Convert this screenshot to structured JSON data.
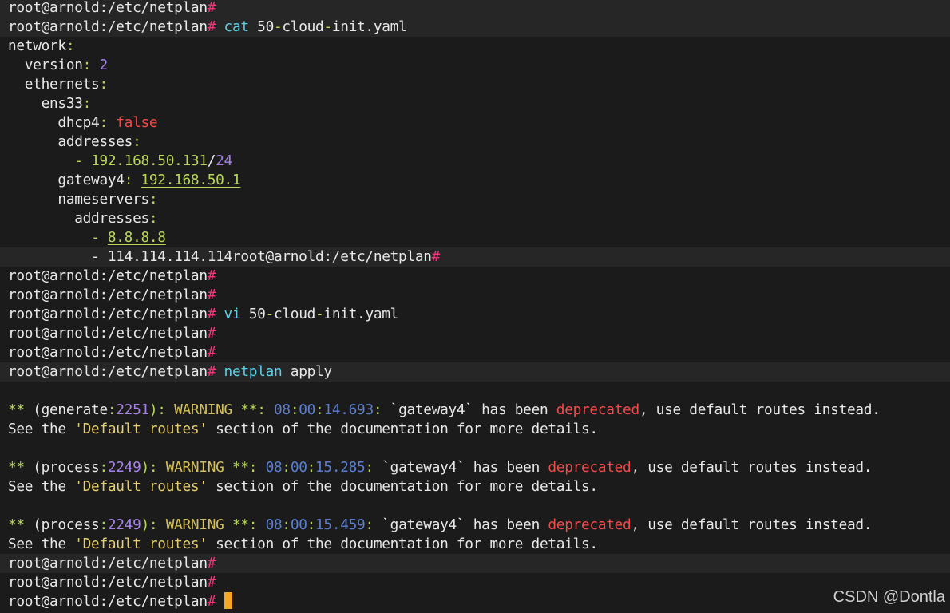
{
  "colors": {
    "default": "#e8e8e8",
    "prompt_hash": "#f0357a",
    "command": "#5ad0e6",
    "yaml_punct": "#b9d75a",
    "number": "#a682e6",
    "bool_false": "#f24a4a",
    "ip": "#b9d75a",
    "warning": "#d4c05a",
    "timestamp": "#5a7fd0",
    "deprecated": "#f24a4a",
    "quoted": "#e6cf6e",
    "cursor": "#f5a623",
    "highlight_bg": "#262626"
  },
  "cursor_line": 31,
  "lines": [
    {
      "hl": true,
      "segments": [
        {
          "text": "root@arnold:/etc/netplan",
          "c": "default"
        },
        {
          "text": "#",
          "c": "prompt_hash"
        }
      ]
    },
    {
      "hl": true,
      "segments": [
        {
          "text": "root@arnold:/etc/netplan",
          "c": "default"
        },
        {
          "text": "# ",
          "c": "prompt_hash"
        },
        {
          "text": "cat",
          "c": "command"
        },
        {
          "text": " 50",
          "c": "default"
        },
        {
          "text": "-",
          "c": "yaml_punct"
        },
        {
          "text": "cloud",
          "c": "default"
        },
        {
          "text": "-",
          "c": "yaml_punct"
        },
        {
          "text": "init.yaml",
          "c": "default"
        }
      ]
    },
    {
      "hl": false,
      "segments": [
        {
          "text": "network",
          "c": "default"
        },
        {
          "text": ":",
          "c": "yaml_punct"
        }
      ]
    },
    {
      "hl": false,
      "segments": [
        {
          "text": "  version",
          "c": "default"
        },
        {
          "text": ": ",
          "c": "yaml_punct"
        },
        {
          "text": "2",
          "c": "number"
        }
      ]
    },
    {
      "hl": false,
      "segments": [
        {
          "text": "  ethernets",
          "c": "default"
        },
        {
          "text": ":",
          "c": "yaml_punct"
        }
      ]
    },
    {
      "hl": false,
      "segments": [
        {
          "text": "    ens33",
          "c": "default"
        },
        {
          "text": ":",
          "c": "yaml_punct"
        }
      ]
    },
    {
      "hl": false,
      "segments": [
        {
          "text": "      dhcp4",
          "c": "default"
        },
        {
          "text": ": ",
          "c": "yaml_punct"
        },
        {
          "text": "false",
          "c": "bool_false"
        }
      ]
    },
    {
      "hl": false,
      "segments": [
        {
          "text": "      addresses",
          "c": "default"
        },
        {
          "text": ":",
          "c": "yaml_punct"
        }
      ]
    },
    {
      "hl": false,
      "segments": [
        {
          "text": "        ",
          "c": "default"
        },
        {
          "text": "- ",
          "c": "yaml_punct"
        },
        {
          "text": "192.168.50.131",
          "c": "ip",
          "u": true
        },
        {
          "text": "/",
          "c": "default"
        },
        {
          "text": "24",
          "c": "number"
        }
      ]
    },
    {
      "hl": false,
      "segments": [
        {
          "text": "      gateway4",
          "c": "default"
        },
        {
          "text": ": ",
          "c": "yaml_punct"
        },
        {
          "text": "192.168.50.1",
          "c": "ip",
          "u": true
        }
      ]
    },
    {
      "hl": false,
      "segments": [
        {
          "text": "      nameservers",
          "c": "default"
        },
        {
          "text": ":",
          "c": "yaml_punct"
        }
      ]
    },
    {
      "hl": false,
      "segments": [
        {
          "text": "        addresses",
          "c": "default"
        },
        {
          "text": ":",
          "c": "yaml_punct"
        }
      ]
    },
    {
      "hl": false,
      "segments": [
        {
          "text": "          ",
          "c": "default"
        },
        {
          "text": "- ",
          "c": "yaml_punct"
        },
        {
          "text": "8.8.8.8",
          "c": "ip",
          "u": true
        }
      ]
    },
    {
      "hl": true,
      "segments": [
        {
          "text": "          - 114.114.114.114root@arnold:/etc/netplan",
          "c": "default"
        },
        {
          "text": "#",
          "c": "prompt_hash"
        }
      ]
    },
    {
      "hl": false,
      "segments": [
        {
          "text": "root@arnold:/etc/netplan",
          "c": "default"
        },
        {
          "text": "#",
          "c": "prompt_hash"
        }
      ]
    },
    {
      "hl": false,
      "segments": [
        {
          "text": "root@arnold:/etc/netplan",
          "c": "default"
        },
        {
          "text": "#",
          "c": "prompt_hash"
        }
      ]
    },
    {
      "hl": false,
      "segments": [
        {
          "text": "root@arnold:/etc/netplan",
          "c": "default"
        },
        {
          "text": "# ",
          "c": "prompt_hash"
        },
        {
          "text": "vi",
          "c": "command"
        },
        {
          "text": " 50",
          "c": "default"
        },
        {
          "text": "-",
          "c": "yaml_punct"
        },
        {
          "text": "cloud",
          "c": "default"
        },
        {
          "text": "-",
          "c": "yaml_punct"
        },
        {
          "text": "init.yaml",
          "c": "default"
        }
      ]
    },
    {
      "hl": false,
      "segments": [
        {
          "text": "root@arnold:/etc/netplan",
          "c": "default"
        },
        {
          "text": "#",
          "c": "prompt_hash"
        }
      ]
    },
    {
      "hl": false,
      "segments": [
        {
          "text": "root@arnold:/etc/netplan",
          "c": "default"
        },
        {
          "text": "#",
          "c": "prompt_hash"
        }
      ]
    },
    {
      "hl": true,
      "segments": [
        {
          "text": "root@arnold:/etc/netplan",
          "c": "default"
        },
        {
          "text": "# ",
          "c": "prompt_hash"
        },
        {
          "text": "netplan",
          "c": "command"
        },
        {
          "text": " apply",
          "c": "default"
        }
      ]
    },
    {
      "hl": false,
      "segments": []
    },
    {
      "hl": false,
      "segments": [
        {
          "text": "** ",
          "c": "yaml_punct"
        },
        {
          "text": "(generate",
          "c": "default"
        },
        {
          "text": ":",
          "c": "yaml_punct"
        },
        {
          "text": "2251",
          "c": "number"
        },
        {
          "text": "): ",
          "c": "yaml_punct"
        },
        {
          "text": "WARNING ",
          "c": "warning"
        },
        {
          "text": "**",
          "c": "yaml_punct"
        },
        {
          "text": ": ",
          "c": "yaml_punct"
        },
        {
          "text": "08",
          "c": "timestamp"
        },
        {
          "text": ":",
          "c": "yaml_punct"
        },
        {
          "text": "00",
          "c": "timestamp"
        },
        {
          "text": ":",
          "c": "yaml_punct"
        },
        {
          "text": "14.693",
          "c": "timestamp"
        },
        {
          "text": ": ",
          "c": "yaml_punct"
        },
        {
          "text": "`gateway4` has been ",
          "c": "default"
        },
        {
          "text": "deprecated",
          "c": "deprecated"
        },
        {
          "text": ", use default routes instead.",
          "c": "default"
        }
      ]
    },
    {
      "hl": false,
      "segments": [
        {
          "text": "See the ",
          "c": "default"
        },
        {
          "text": "'Default routes'",
          "c": "quoted"
        },
        {
          "text": " section of the documentation for more details.",
          "c": "default"
        }
      ]
    },
    {
      "hl": false,
      "segments": []
    },
    {
      "hl": false,
      "segments": [
        {
          "text": "** ",
          "c": "yaml_punct"
        },
        {
          "text": "(process",
          "c": "default"
        },
        {
          "text": ":",
          "c": "yaml_punct"
        },
        {
          "text": "2249",
          "c": "number"
        },
        {
          "text": "): ",
          "c": "yaml_punct"
        },
        {
          "text": "WARNING ",
          "c": "warning"
        },
        {
          "text": "**",
          "c": "yaml_punct"
        },
        {
          "text": ": ",
          "c": "yaml_punct"
        },
        {
          "text": "08",
          "c": "timestamp"
        },
        {
          "text": ":",
          "c": "yaml_punct"
        },
        {
          "text": "00",
          "c": "timestamp"
        },
        {
          "text": ":",
          "c": "yaml_punct"
        },
        {
          "text": "15.285",
          "c": "timestamp"
        },
        {
          "text": ": ",
          "c": "yaml_punct"
        },
        {
          "text": "`gateway4` has been ",
          "c": "default"
        },
        {
          "text": "deprecated",
          "c": "deprecated"
        },
        {
          "text": ", use default routes instead.",
          "c": "default"
        }
      ]
    },
    {
      "hl": false,
      "segments": [
        {
          "text": "See the ",
          "c": "default"
        },
        {
          "text": "'Default routes'",
          "c": "quoted"
        },
        {
          "text": " section of the documentation for more details.",
          "c": "default"
        }
      ]
    },
    {
      "hl": false,
      "segments": []
    },
    {
      "hl": false,
      "segments": [
        {
          "text": "** ",
          "c": "yaml_punct"
        },
        {
          "text": "(process",
          "c": "default"
        },
        {
          "text": ":",
          "c": "yaml_punct"
        },
        {
          "text": "2249",
          "c": "number"
        },
        {
          "text": "): ",
          "c": "yaml_punct"
        },
        {
          "text": "WARNING ",
          "c": "warning"
        },
        {
          "text": "**",
          "c": "yaml_punct"
        },
        {
          "text": ": ",
          "c": "yaml_punct"
        },
        {
          "text": "08",
          "c": "timestamp"
        },
        {
          "text": ":",
          "c": "yaml_punct"
        },
        {
          "text": "00",
          "c": "timestamp"
        },
        {
          "text": ":",
          "c": "yaml_punct"
        },
        {
          "text": "15.459",
          "c": "timestamp"
        },
        {
          "text": ": ",
          "c": "yaml_punct"
        },
        {
          "text": "`gateway4` has been ",
          "c": "default"
        },
        {
          "text": "deprecated",
          "c": "deprecated"
        },
        {
          "text": ", use default routes instead.",
          "c": "default"
        }
      ]
    },
    {
      "hl": false,
      "segments": [
        {
          "text": "See the ",
          "c": "default"
        },
        {
          "text": "'Default routes'",
          "c": "quoted"
        },
        {
          "text": " section of the documentation for more details.",
          "c": "default"
        }
      ]
    },
    {
      "hl": true,
      "segments": [
        {
          "text": "root@arnold:/etc/netplan",
          "c": "default"
        },
        {
          "text": "#",
          "c": "prompt_hash"
        }
      ]
    },
    {
      "hl": false,
      "segments": [
        {
          "text": "root@arnold:/etc/netplan",
          "c": "default"
        },
        {
          "text": "#",
          "c": "prompt_hash"
        }
      ]
    },
    {
      "hl": false,
      "segments": [
        {
          "text": "root@arnold:/etc/netplan",
          "c": "default"
        },
        {
          "text": "# ",
          "c": "prompt_hash"
        }
      ]
    }
  ],
  "watermark": "CSDN @Dontla"
}
